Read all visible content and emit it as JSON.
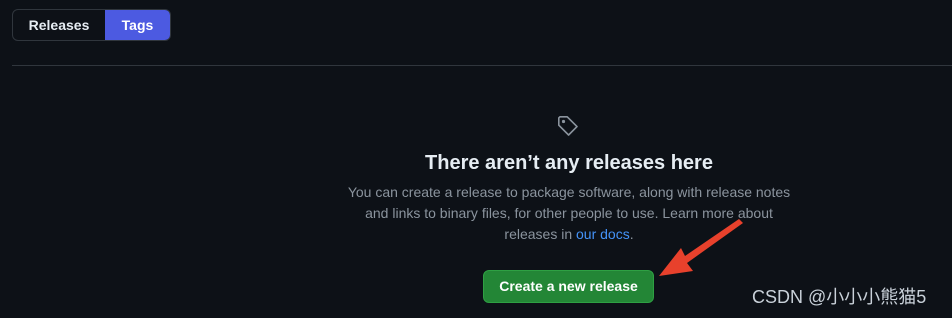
{
  "tabs": [
    {
      "label": "Releases",
      "active": false
    },
    {
      "label": "Tags",
      "active": true
    }
  ],
  "blank_slate": {
    "icon": "tag-icon",
    "title": "There aren’t any releases here",
    "description_line1": "You can create a release to package software, along with release notes",
    "description_line2": "and links to binary files, for other people to use. Learn more about",
    "description_line3_prefix": "releases in ",
    "docs_link": "our docs",
    "description_line3_suffix": ".",
    "create_button_label": "Create a new release"
  },
  "annotation": {
    "arrow": "red-arrow-pointing-to-button",
    "color": "#e8412c"
  },
  "watermark": "CSDN @小小小熊猫5",
  "colors": {
    "background": "#0d1117",
    "tab_active": "#4c5ae1",
    "button": "#238636",
    "link": "#4493f8",
    "muted_text": "#8b949e"
  }
}
